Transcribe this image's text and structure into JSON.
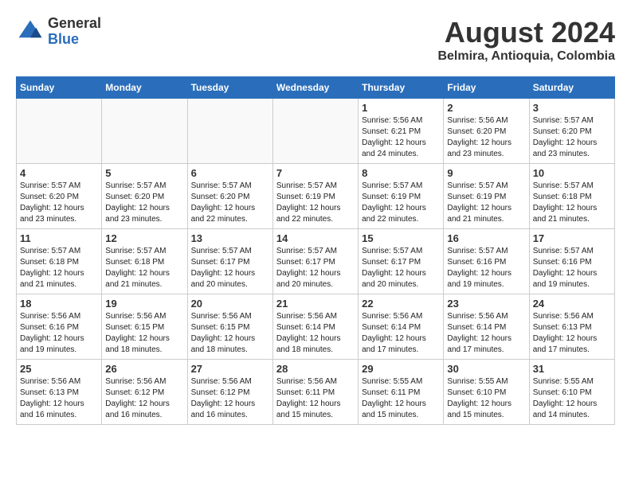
{
  "header": {
    "logo_general": "General",
    "logo_blue": "Blue",
    "month_year": "August 2024",
    "location": "Belmira, Antioquia, Colombia"
  },
  "days_of_week": [
    "Sunday",
    "Monday",
    "Tuesday",
    "Wednesday",
    "Thursday",
    "Friday",
    "Saturday"
  ],
  "weeks": [
    [
      {
        "day": "",
        "info": ""
      },
      {
        "day": "",
        "info": ""
      },
      {
        "day": "",
        "info": ""
      },
      {
        "day": "",
        "info": ""
      },
      {
        "day": "1",
        "info": "Sunrise: 5:56 AM\nSunset: 6:21 PM\nDaylight: 12 hours\nand 24 minutes."
      },
      {
        "day": "2",
        "info": "Sunrise: 5:56 AM\nSunset: 6:20 PM\nDaylight: 12 hours\nand 23 minutes."
      },
      {
        "day": "3",
        "info": "Sunrise: 5:57 AM\nSunset: 6:20 PM\nDaylight: 12 hours\nand 23 minutes."
      }
    ],
    [
      {
        "day": "4",
        "info": "Sunrise: 5:57 AM\nSunset: 6:20 PM\nDaylight: 12 hours\nand 23 minutes."
      },
      {
        "day": "5",
        "info": "Sunrise: 5:57 AM\nSunset: 6:20 PM\nDaylight: 12 hours\nand 23 minutes."
      },
      {
        "day": "6",
        "info": "Sunrise: 5:57 AM\nSunset: 6:20 PM\nDaylight: 12 hours\nand 22 minutes."
      },
      {
        "day": "7",
        "info": "Sunrise: 5:57 AM\nSunset: 6:19 PM\nDaylight: 12 hours\nand 22 minutes."
      },
      {
        "day": "8",
        "info": "Sunrise: 5:57 AM\nSunset: 6:19 PM\nDaylight: 12 hours\nand 22 minutes."
      },
      {
        "day": "9",
        "info": "Sunrise: 5:57 AM\nSunset: 6:19 PM\nDaylight: 12 hours\nand 21 minutes."
      },
      {
        "day": "10",
        "info": "Sunrise: 5:57 AM\nSunset: 6:18 PM\nDaylight: 12 hours\nand 21 minutes."
      }
    ],
    [
      {
        "day": "11",
        "info": "Sunrise: 5:57 AM\nSunset: 6:18 PM\nDaylight: 12 hours\nand 21 minutes."
      },
      {
        "day": "12",
        "info": "Sunrise: 5:57 AM\nSunset: 6:18 PM\nDaylight: 12 hours\nand 21 minutes."
      },
      {
        "day": "13",
        "info": "Sunrise: 5:57 AM\nSunset: 6:17 PM\nDaylight: 12 hours\nand 20 minutes."
      },
      {
        "day": "14",
        "info": "Sunrise: 5:57 AM\nSunset: 6:17 PM\nDaylight: 12 hours\nand 20 minutes."
      },
      {
        "day": "15",
        "info": "Sunrise: 5:57 AM\nSunset: 6:17 PM\nDaylight: 12 hours\nand 20 minutes."
      },
      {
        "day": "16",
        "info": "Sunrise: 5:57 AM\nSunset: 6:16 PM\nDaylight: 12 hours\nand 19 minutes."
      },
      {
        "day": "17",
        "info": "Sunrise: 5:57 AM\nSunset: 6:16 PM\nDaylight: 12 hours\nand 19 minutes."
      }
    ],
    [
      {
        "day": "18",
        "info": "Sunrise: 5:56 AM\nSunset: 6:16 PM\nDaylight: 12 hours\nand 19 minutes."
      },
      {
        "day": "19",
        "info": "Sunrise: 5:56 AM\nSunset: 6:15 PM\nDaylight: 12 hours\nand 18 minutes."
      },
      {
        "day": "20",
        "info": "Sunrise: 5:56 AM\nSunset: 6:15 PM\nDaylight: 12 hours\nand 18 minutes."
      },
      {
        "day": "21",
        "info": "Sunrise: 5:56 AM\nSunset: 6:14 PM\nDaylight: 12 hours\nand 18 minutes."
      },
      {
        "day": "22",
        "info": "Sunrise: 5:56 AM\nSunset: 6:14 PM\nDaylight: 12 hours\nand 17 minutes."
      },
      {
        "day": "23",
        "info": "Sunrise: 5:56 AM\nSunset: 6:14 PM\nDaylight: 12 hours\nand 17 minutes."
      },
      {
        "day": "24",
        "info": "Sunrise: 5:56 AM\nSunset: 6:13 PM\nDaylight: 12 hours\nand 17 minutes."
      }
    ],
    [
      {
        "day": "25",
        "info": "Sunrise: 5:56 AM\nSunset: 6:13 PM\nDaylight: 12 hours\nand 16 minutes."
      },
      {
        "day": "26",
        "info": "Sunrise: 5:56 AM\nSunset: 6:12 PM\nDaylight: 12 hours\nand 16 minutes."
      },
      {
        "day": "27",
        "info": "Sunrise: 5:56 AM\nSunset: 6:12 PM\nDaylight: 12 hours\nand 16 minutes."
      },
      {
        "day": "28",
        "info": "Sunrise: 5:56 AM\nSunset: 6:11 PM\nDaylight: 12 hours\nand 15 minutes."
      },
      {
        "day": "29",
        "info": "Sunrise: 5:55 AM\nSunset: 6:11 PM\nDaylight: 12 hours\nand 15 minutes."
      },
      {
        "day": "30",
        "info": "Sunrise: 5:55 AM\nSunset: 6:10 PM\nDaylight: 12 hours\nand 15 minutes."
      },
      {
        "day": "31",
        "info": "Sunrise: 5:55 AM\nSunset: 6:10 PM\nDaylight: 12 hours\nand 14 minutes."
      }
    ]
  ]
}
